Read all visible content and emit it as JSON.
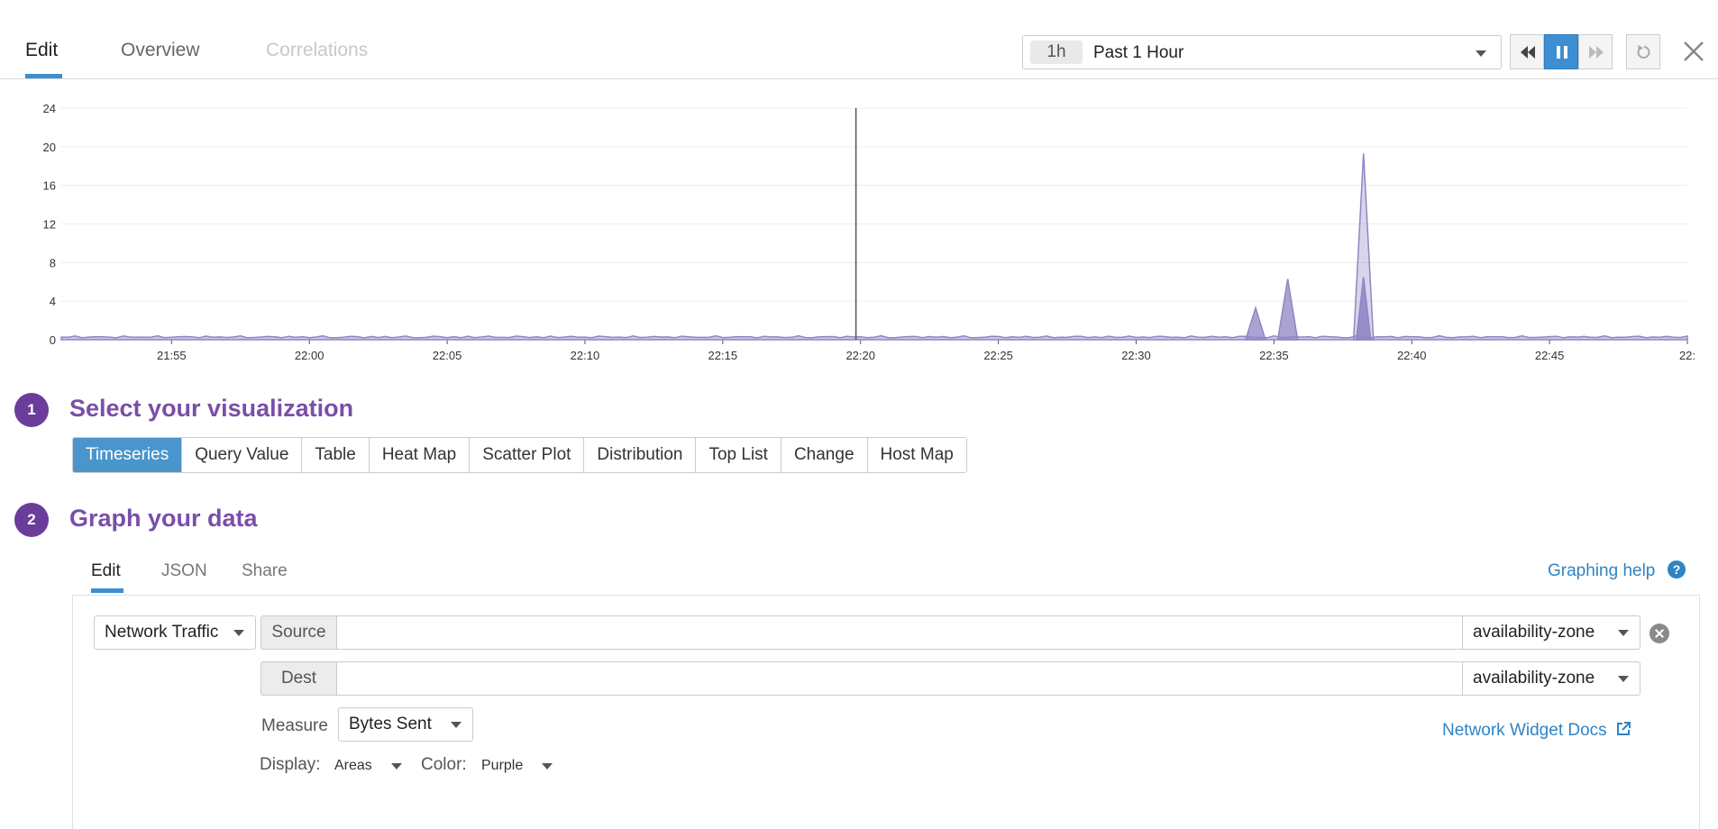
{
  "tabs": {
    "edit": "Edit",
    "overview": "Overview",
    "correlations": "Correlations"
  },
  "time": {
    "badge": "1h",
    "label": "Past 1 Hour"
  },
  "controls": {
    "icons": [
      "rewind-icon",
      "pause-icon",
      "fast-forward-icon",
      "reset-icon",
      "close-icon"
    ],
    "active": "pause-icon"
  },
  "chart_data": {
    "type": "area",
    "color": "#8f86c4",
    "ylim": [
      0,
      24
    ],
    "yticks": [
      "0",
      "4",
      "8",
      "12",
      "16",
      "20",
      "24"
    ],
    "xticks": [
      "21:55",
      "22:00",
      "22:05",
      "22:10",
      "22:15",
      "22:20",
      "22:25",
      "22:30",
      "22:35",
      "22:40",
      "22:45",
      "22:"
    ],
    "x_range_minutes": [
      "21:51",
      "22:50"
    ],
    "baseline_value": 0.4,
    "peaks": [
      {
        "time": "22:34:20",
        "value": 3.3
      },
      {
        "time": "22:35:30",
        "value": 6.3
      },
      {
        "time": "22:38:15",
        "value": 19.3
      },
      {
        "time": "22:38:15",
        "value": 6.5
      }
    ],
    "marker_time": "22:19:50"
  },
  "section1": {
    "number": "1",
    "title": "Select your visualization",
    "options": [
      "Timeseries",
      "Query Value",
      "Table",
      "Heat Map",
      "Scatter Plot",
      "Distribution",
      "Top List",
      "Change",
      "Host Map"
    ],
    "selected": "Timeseries"
  },
  "section2": {
    "number": "2",
    "title": "Graph your data",
    "tabs": [
      "Edit",
      "JSON",
      "Share"
    ],
    "active_tab": "Edit",
    "help": "Graphing help",
    "help_icon": "?"
  },
  "editor": {
    "widget_type": "Network Traffic",
    "source_label": "Source",
    "dest_label": "Dest",
    "source_group": "availability-zone",
    "dest_group": "availability-zone",
    "measure_label": "Measure",
    "measure_value": "Bytes Sent",
    "display_label": "Display:",
    "display_value": "Areas",
    "color_label": "Color:",
    "color_value": "Purple",
    "docs_link": "Network Widget Docs"
  }
}
